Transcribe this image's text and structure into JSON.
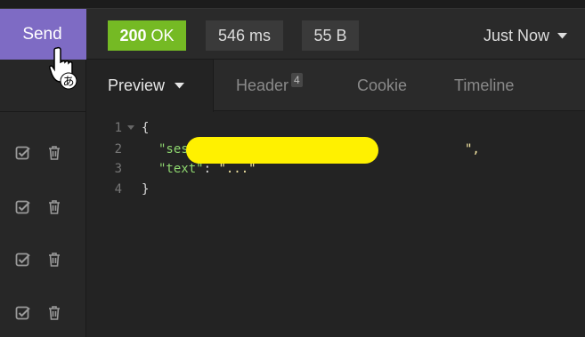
{
  "send_button": {
    "label": "Send"
  },
  "status": {
    "code": "200",
    "text": "OK",
    "time": "546 ms",
    "size": "55 B",
    "history": "Just Now",
    "ok_color": "#75ba24"
  },
  "tabs": [
    {
      "label": "Preview"
    },
    {
      "label": "Header",
      "count": "4"
    },
    {
      "label": "Cookie"
    },
    {
      "label": "Timeline"
    }
  ],
  "code": {
    "line_numbers": [
      "1",
      "2",
      "3",
      "4"
    ],
    "open_brace": "{",
    "close_brace": "}",
    "key1": "\"sessionid\"",
    "key2": "\"text\"",
    "colon": ": ",
    "value1_open": "\"",
    "value1_close": "\",",
    "value2": "\"...\""
  },
  "left_rows": [
    {
      "icons": [
        "checkbox-icon",
        "trash-icon"
      ]
    },
    {
      "icons": [
        "checkbox-icon",
        "trash-icon"
      ]
    },
    {
      "icons": [
        "checkbox-icon",
        "trash-icon"
      ]
    },
    {
      "icons": [
        "checkbox-icon",
        "trash-icon"
      ]
    }
  ],
  "cursor_glyph": "あ",
  "send_color": "#7e6bc4",
  "redaction_color": "#fff100"
}
